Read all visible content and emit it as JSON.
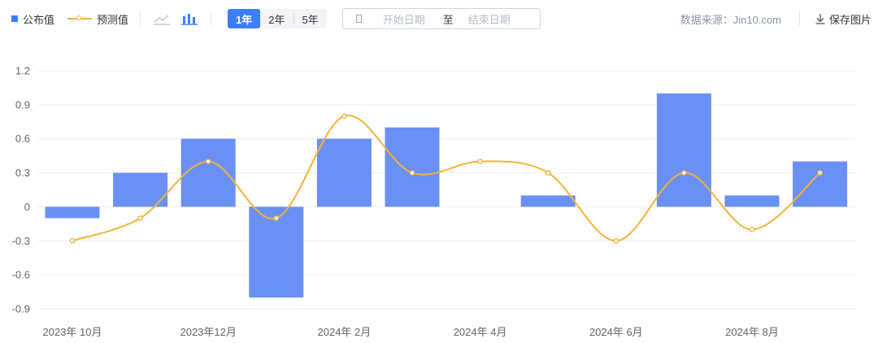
{
  "toolbar": {
    "legend_published": "公布值",
    "legend_forecast": "预测值",
    "range_buttons": [
      "1年",
      "2年",
      "5年"
    ],
    "active_range": "1年",
    "date_start_placeholder": "开始日期",
    "date_to": "至",
    "date_end_placeholder": "结束日期",
    "source": "数据来源：Jin10.com",
    "save_label": "保存图片",
    "icons": [
      "line-chart-icon",
      "bar-chart-icon",
      "calendar-icon",
      "download-icon"
    ]
  },
  "colors": {
    "bar": "#6b90f5",
    "line": "#f2b33d",
    "accent": "#3d7eff",
    "grid": "#ececec",
    "axis_text": "#666666"
  },
  "chart_data": {
    "type": "bar",
    "categories": [
      "2023-10",
      "2023-11",
      "2023-12",
      "2024-01",
      "2024-02",
      "2024-03",
      "2024-04",
      "2024-05",
      "2024-06",
      "2024-07",
      "2024-08",
      "2024-09"
    ],
    "series": [
      {
        "name": "公布值",
        "type": "bar",
        "values": [
          -0.1,
          0.3,
          0.6,
          -0.8,
          0.6,
          0.7,
          0.0,
          0.1,
          0.0,
          1.0,
          0.1,
          0.4
        ]
      },
      {
        "name": "预测值",
        "type": "line",
        "values": [
          -0.3,
          -0.1,
          0.4,
          -0.1,
          0.8,
          0.3,
          0.4,
          0.3,
          -0.3,
          0.3,
          -0.2,
          0.3
        ]
      }
    ],
    "x_tick_labels": [
      {
        "index": 0,
        "label": "2023年 10月"
      },
      {
        "index": 2,
        "label": "2023年12月"
      },
      {
        "index": 4,
        "label": "2024年 2月"
      },
      {
        "index": 6,
        "label": "2024年 4月"
      },
      {
        "index": 8,
        "label": "2024年 6月"
      },
      {
        "index": 10,
        "label": "2024年 8月"
      }
    ],
    "y_ticks": [
      1.2,
      0.9,
      0.6,
      0.3,
      0,
      -0.3,
      -0.6,
      -0.9
    ],
    "y_tick_labels": [
      "1.2",
      "0.9",
      "0.6",
      "0.3",
      "0",
      "-0.3",
      "-0.6",
      "-0.9"
    ],
    "ylim": [
      -0.9,
      1.2
    ],
    "grid": true,
    "legend": "top-left"
  }
}
